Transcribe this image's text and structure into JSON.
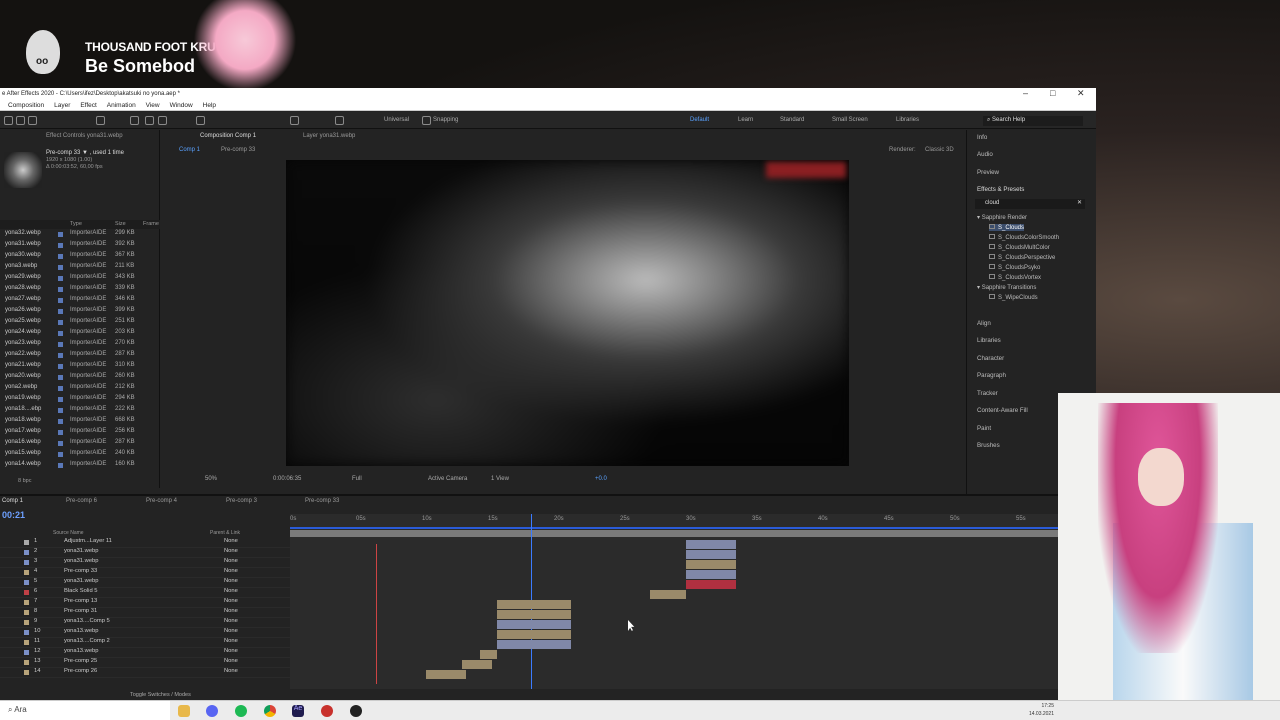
{
  "stream_overlay": {
    "artist": "THOUSAND FOOT KRU",
    "song": "Be Somebod"
  },
  "window": {
    "title": "e After Effects 2020 - C:\\Users\\ifez\\Desktop\\akatsuki no yona.aep *"
  },
  "menu": [
    "Composition",
    "Layer",
    "Effect",
    "Animation",
    "View",
    "Window",
    "Help"
  ],
  "toolbar": {
    "universal": "Universal",
    "snapping": "Snapping",
    "workspaces": [
      "Default",
      "Learn",
      "Standard",
      "Small Screen",
      "Libraries"
    ],
    "search": "Search Help"
  },
  "project": {
    "tab_effect_controls": "Effect Controls yona31.webp",
    "item_name": "Pre-comp 33 ▼ , used 1 time",
    "item_res": "1920 x 1080 (1.00)",
    "item_dur": "Δ 0:00:03:52, 60,00 fps",
    "columns": [
      "Type",
      "Size",
      "Frame"
    ],
    "rows": [
      {
        "name": "yona32.webp",
        "type": "ImporterAIDE",
        "size": "299 KB"
      },
      {
        "name": "yona31.webp",
        "type": "ImporterAIDE",
        "size": "392 KB"
      },
      {
        "name": "yona30.webp",
        "type": "ImporterAIDE",
        "size": "367 KB"
      },
      {
        "name": "yona3.webp",
        "type": "ImporterAIDE",
        "size": "211 KB"
      },
      {
        "name": "yona29.webp",
        "type": "ImporterAIDE",
        "size": "343 KB"
      },
      {
        "name": "yona28.webp",
        "type": "ImporterAIDE",
        "size": "339 KB"
      },
      {
        "name": "yona27.webp",
        "type": "ImporterAIDE",
        "size": "346 KB"
      },
      {
        "name": "yona26.webp",
        "type": "ImporterAIDE",
        "size": "399 KB"
      },
      {
        "name": "yona25.webp",
        "type": "ImporterAIDE",
        "size": "251 KB"
      },
      {
        "name": "yona24.webp",
        "type": "ImporterAIDE",
        "size": "203 KB"
      },
      {
        "name": "yona23.webp",
        "type": "ImporterAIDE",
        "size": "270 KB"
      },
      {
        "name": "yona22.webp",
        "type": "ImporterAIDE",
        "size": "287 KB"
      },
      {
        "name": "yona21.webp",
        "type": "ImporterAIDE",
        "size": "310 KB"
      },
      {
        "name": "yona20.webp",
        "type": "ImporterAIDE",
        "size": "260 KB"
      },
      {
        "name": "yona2.webp",
        "type": "ImporterAIDE",
        "size": "212 KB"
      },
      {
        "name": "yona19.webp",
        "type": "ImporterAIDE",
        "size": "294 KB"
      },
      {
        "name": "yona18....ebp",
        "type": "ImporterAIDE",
        "size": "222 KB"
      },
      {
        "name": "yona18.webp",
        "type": "ImporterAIDE",
        "size": "668 KB"
      },
      {
        "name": "yona17.webp",
        "type": "ImporterAIDE",
        "size": "256 KB"
      },
      {
        "name": "yona16.webp",
        "type": "ImporterAIDE",
        "size": "287 KB"
      },
      {
        "name": "yona15.webp",
        "type": "ImporterAIDE",
        "size": "240 KB"
      },
      {
        "name": "yona14.webp",
        "type": "ImporterAIDE",
        "size": "160 KB"
      }
    ],
    "bpc": "8 bpc"
  },
  "composition": {
    "tab": "Composition Comp 1",
    "layer_tab": "Layer yona31.webp",
    "sub_tabs": [
      "Comp 1",
      "Pre-comp 33"
    ],
    "renderer_label": "Renderer:",
    "renderer": "Classic 3D",
    "zoom": "50%",
    "time": "0:00:06:35",
    "resolution": "Full",
    "camera": "Active Camera",
    "views": "1 View",
    "exposure": "+0.0"
  },
  "right_panel": {
    "top": [
      "Info",
      "Audio",
      "Preview"
    ],
    "effects_title": "Effects & Presets",
    "search": "cloud",
    "groups": [
      {
        "name": "Sapphire Render",
        "items": [
          "S_Clouds",
          "S_CloudsColorSmooth",
          "S_CloudsMultColor",
          "S_CloudsPerspective",
          "S_CloudsPsyko",
          "S_CloudsVortex"
        ]
      },
      {
        "name": "Sapphire Transitions",
        "items": [
          "S_WipeClouds"
        ]
      }
    ],
    "bottom": [
      "Align",
      "Libraries",
      "Character",
      "Paragraph",
      "Tracker",
      "Content-Aware Fill",
      "Paint",
      "Brushes"
    ]
  },
  "timeline": {
    "tabs": [
      "Comp 1",
      "Pre-comp 6",
      "Pre-comp 4",
      "Pre-comp 3",
      "Pre-comp 33"
    ],
    "timecode": "00:21",
    "col_source": "Source Name",
    "col_parent": "Parent & Link",
    "ruler": [
      "0s",
      "05s",
      "10s",
      "15s",
      "20s",
      "25s",
      "30s",
      "35s",
      "40s",
      "45s",
      "50s",
      "55s"
    ],
    "layers": [
      {
        "n": "1",
        "name": "Adjustm...Layer 11",
        "parent": "None",
        "color": "#a9a9a9"
      },
      {
        "n": "2",
        "name": "yona31.webp",
        "parent": "None",
        "color": "#7b90c8"
      },
      {
        "n": "3",
        "name": "yona31.webp",
        "parent": "None",
        "color": "#7b90c8"
      },
      {
        "n": "4",
        "name": "Pre-comp 33",
        "parent": "None",
        "color": "#b8a47a"
      },
      {
        "n": "5",
        "name": "yona31.webp",
        "parent": "None",
        "color": "#7b90c8"
      },
      {
        "n": "6",
        "name": "Black Solid 5",
        "parent": "None",
        "color": "#c04046"
      },
      {
        "n": "7",
        "name": "Pre-comp 13",
        "parent": "None",
        "color": "#b8a47a"
      },
      {
        "n": "8",
        "name": "Pre-comp 31",
        "parent": "None",
        "color": "#b8a47a"
      },
      {
        "n": "9",
        "name": "yona13....Comp 5",
        "parent": "None",
        "color": "#b8a47a"
      },
      {
        "n": "10",
        "name": "yona13.webp",
        "parent": "None",
        "color": "#7b90c8"
      },
      {
        "n": "11",
        "name": "yona13....Comp 2",
        "parent": "None",
        "color": "#b8a47a"
      },
      {
        "n": "12",
        "name": "yona13.webp",
        "parent": "None",
        "color": "#7b90c8"
      },
      {
        "n": "13",
        "name": "Pre-comp 25",
        "parent": "None",
        "color": "#b8a47a"
      },
      {
        "n": "14",
        "name": "Pre-comp 26",
        "parent": "None",
        "color": "#b8a47a"
      }
    ],
    "footer": "Toggle Switches / Modes"
  },
  "taskbar": {
    "search": "Ara",
    "time": "17:25",
    "date": "14.03.2021"
  }
}
